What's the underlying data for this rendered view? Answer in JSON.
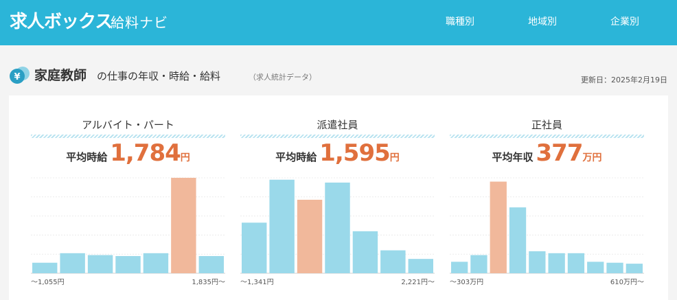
{
  "header": {
    "logo": "求人ボックス",
    "logo_sub": "給料ナビ",
    "nav": [
      "職種別",
      "地域別",
      "企業別"
    ]
  },
  "page": {
    "title_job": "家庭教師",
    "title_rest": "の仕事の年収・時給・給料",
    "title_note": "（求人統計データ）",
    "updated": "更新日：2025年2月19日",
    "icon": "yen-coin-icon"
  },
  "colors": {
    "header_bg": "#2bb5d8",
    "bar_normal": "#9ad9ea",
    "bar_highlight": "#f1b89b",
    "value_orange": "#e0703d"
  },
  "panels": [
    {
      "title": "アルバイト・パート",
      "avg_label": "平均時給",
      "avg_value": "1,784",
      "avg_unit": "円",
      "range_min": "〜1,055円",
      "range_max": "1,835円〜"
    },
    {
      "title": "派遣社員",
      "avg_label": "平均時給",
      "avg_value": "1,595",
      "avg_unit": "円",
      "range_min": "〜1,341円",
      "range_max": "2,221円〜"
    },
    {
      "title": "正社員",
      "avg_label": "平均年収",
      "avg_value": "377",
      "avg_unit": "万円",
      "range_min": "〜303万円",
      "range_max": "610万円〜"
    }
  ],
  "chart_data": [
    {
      "type": "bar",
      "values": [
        11,
        21,
        19,
        18,
        21,
        100,
        18
      ],
      "highlight_index": 5,
      "ylim": [
        0,
        100
      ]
    },
    {
      "type": "bar",
      "values": [
        53,
        98,
        77,
        95,
        44,
        24,
        15
      ],
      "highlight_index": 2,
      "ylim": [
        0,
        100
      ]
    },
    {
      "type": "bar",
      "values": [
        12,
        19,
        96,
        69,
        23,
        21,
        21,
        12,
        11,
        10
      ],
      "highlight_index": 2,
      "ylim": [
        0,
        100
      ]
    }
  ]
}
